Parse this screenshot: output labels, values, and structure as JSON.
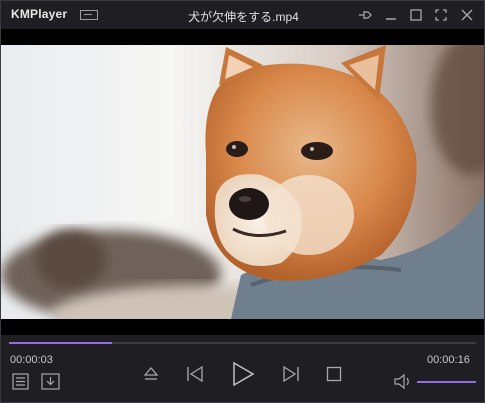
{
  "app": {
    "name": "KMPlayer",
    "file_title": "犬が欠伸をする.mp4"
  },
  "playback": {
    "current_time": "00:00:03",
    "total_time": "00:00:16",
    "progress": 0.22,
    "volume": 1.0
  },
  "icons": {
    "window": [
      "pin-icon",
      "minimize-icon",
      "maximize-icon",
      "fullscreen-icon",
      "close-icon"
    ],
    "transport": [
      "playlist-icon",
      "download-icon",
      "eject-icon",
      "previous-icon",
      "play-icon",
      "next-icon",
      "stop-icon",
      "volume-icon"
    ]
  },
  "colors": {
    "accent": "#8e6ee0",
    "background": "#1f1f23"
  }
}
